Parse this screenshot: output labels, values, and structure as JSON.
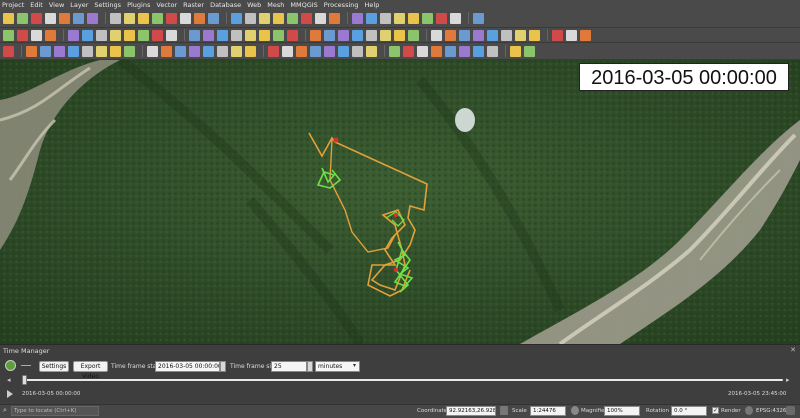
{
  "menu": [
    "Project",
    "Edit",
    "View",
    "Layer",
    "Settings",
    "Plugins",
    "Vector",
    "Raster",
    "Database",
    "Web",
    "Mesh",
    "MMQGIS",
    "Processing",
    "Help"
  ],
  "colors": {
    "track_green": "#6de04a",
    "track_orange": "#e2a13a",
    "track_red": "#d9322b",
    "map_forest": "#2e4b28"
  },
  "map": {
    "timestamp": "2016-03-05 00:00:00"
  },
  "time_manager": {
    "title": "Time Manager",
    "settings_label": "Settings",
    "export_label": "Export Video",
    "frame_start_label": "Time frame start:",
    "frame_start_value": "2016-03-05 00:00:00.000",
    "frame_size_label": "Time frame size:",
    "frame_size_value": "25",
    "unit_value": "minutes",
    "range_start": "2016-03-05 00:00:00",
    "range_end": "2016-03-05 23:45:00",
    "slider_position": 0.0
  },
  "status": {
    "locate_placeholder": "Type to locate (Ctrl+K)",
    "coordinate_label": "Coordinate",
    "coordinate_value": "92.92163,26.92855",
    "scale_label": "Scale",
    "scale_value": "1:24476",
    "magnifier_label": "Magnifier",
    "magnifier_value": "100%",
    "rotation_label": "Rotation",
    "rotation_value": "0.0 °",
    "render_label": "Render",
    "crs_label": "EPSG:4326"
  }
}
